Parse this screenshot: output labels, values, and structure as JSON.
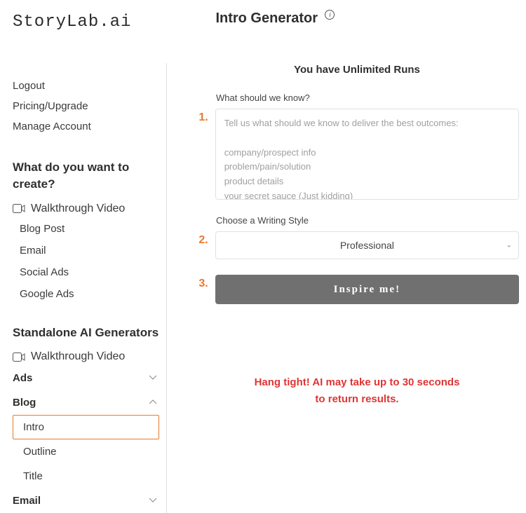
{
  "brand": "StoryLab.ai",
  "page": {
    "title": "Intro Generator",
    "info_tooltip": "i"
  },
  "sidebar": {
    "topLinks": [
      "Logout",
      "Pricing/Upgrade",
      "Manage Account"
    ],
    "createHeading": "What do you want to create?",
    "walkthrough": "Walkthrough Video",
    "createItems": [
      "Blog Post",
      "Email",
      "Social Ads",
      "Google Ads"
    ],
    "standaloneHeading": "Standalone AI Generators",
    "categories": [
      {
        "label": "Ads",
        "expanded": false
      },
      {
        "label": "Blog",
        "expanded": true,
        "children": [
          {
            "label": "Intro",
            "active": true
          },
          {
            "label": "Outline",
            "active": false
          },
          {
            "label": "Title",
            "active": false
          }
        ]
      },
      {
        "label": "Email",
        "expanded": false
      }
    ]
  },
  "main": {
    "runs": "You have Unlimited Runs",
    "step1": {
      "label": "What should we know?",
      "num": "1.",
      "placeholder": "Tell us what should we know to deliver the best outcomes:\n\ncompany/prospect info\nproblem/pain/solution\nproduct details\nyour secret sauce (Just kidding)"
    },
    "step2": {
      "label": "Choose a Writing Style",
      "num": "2.",
      "selected": "Professional"
    },
    "step3": {
      "num": "3.",
      "cta": "Inspire me!"
    },
    "wait": "Hang tight! AI may take up to 30 seconds\nto return results."
  }
}
